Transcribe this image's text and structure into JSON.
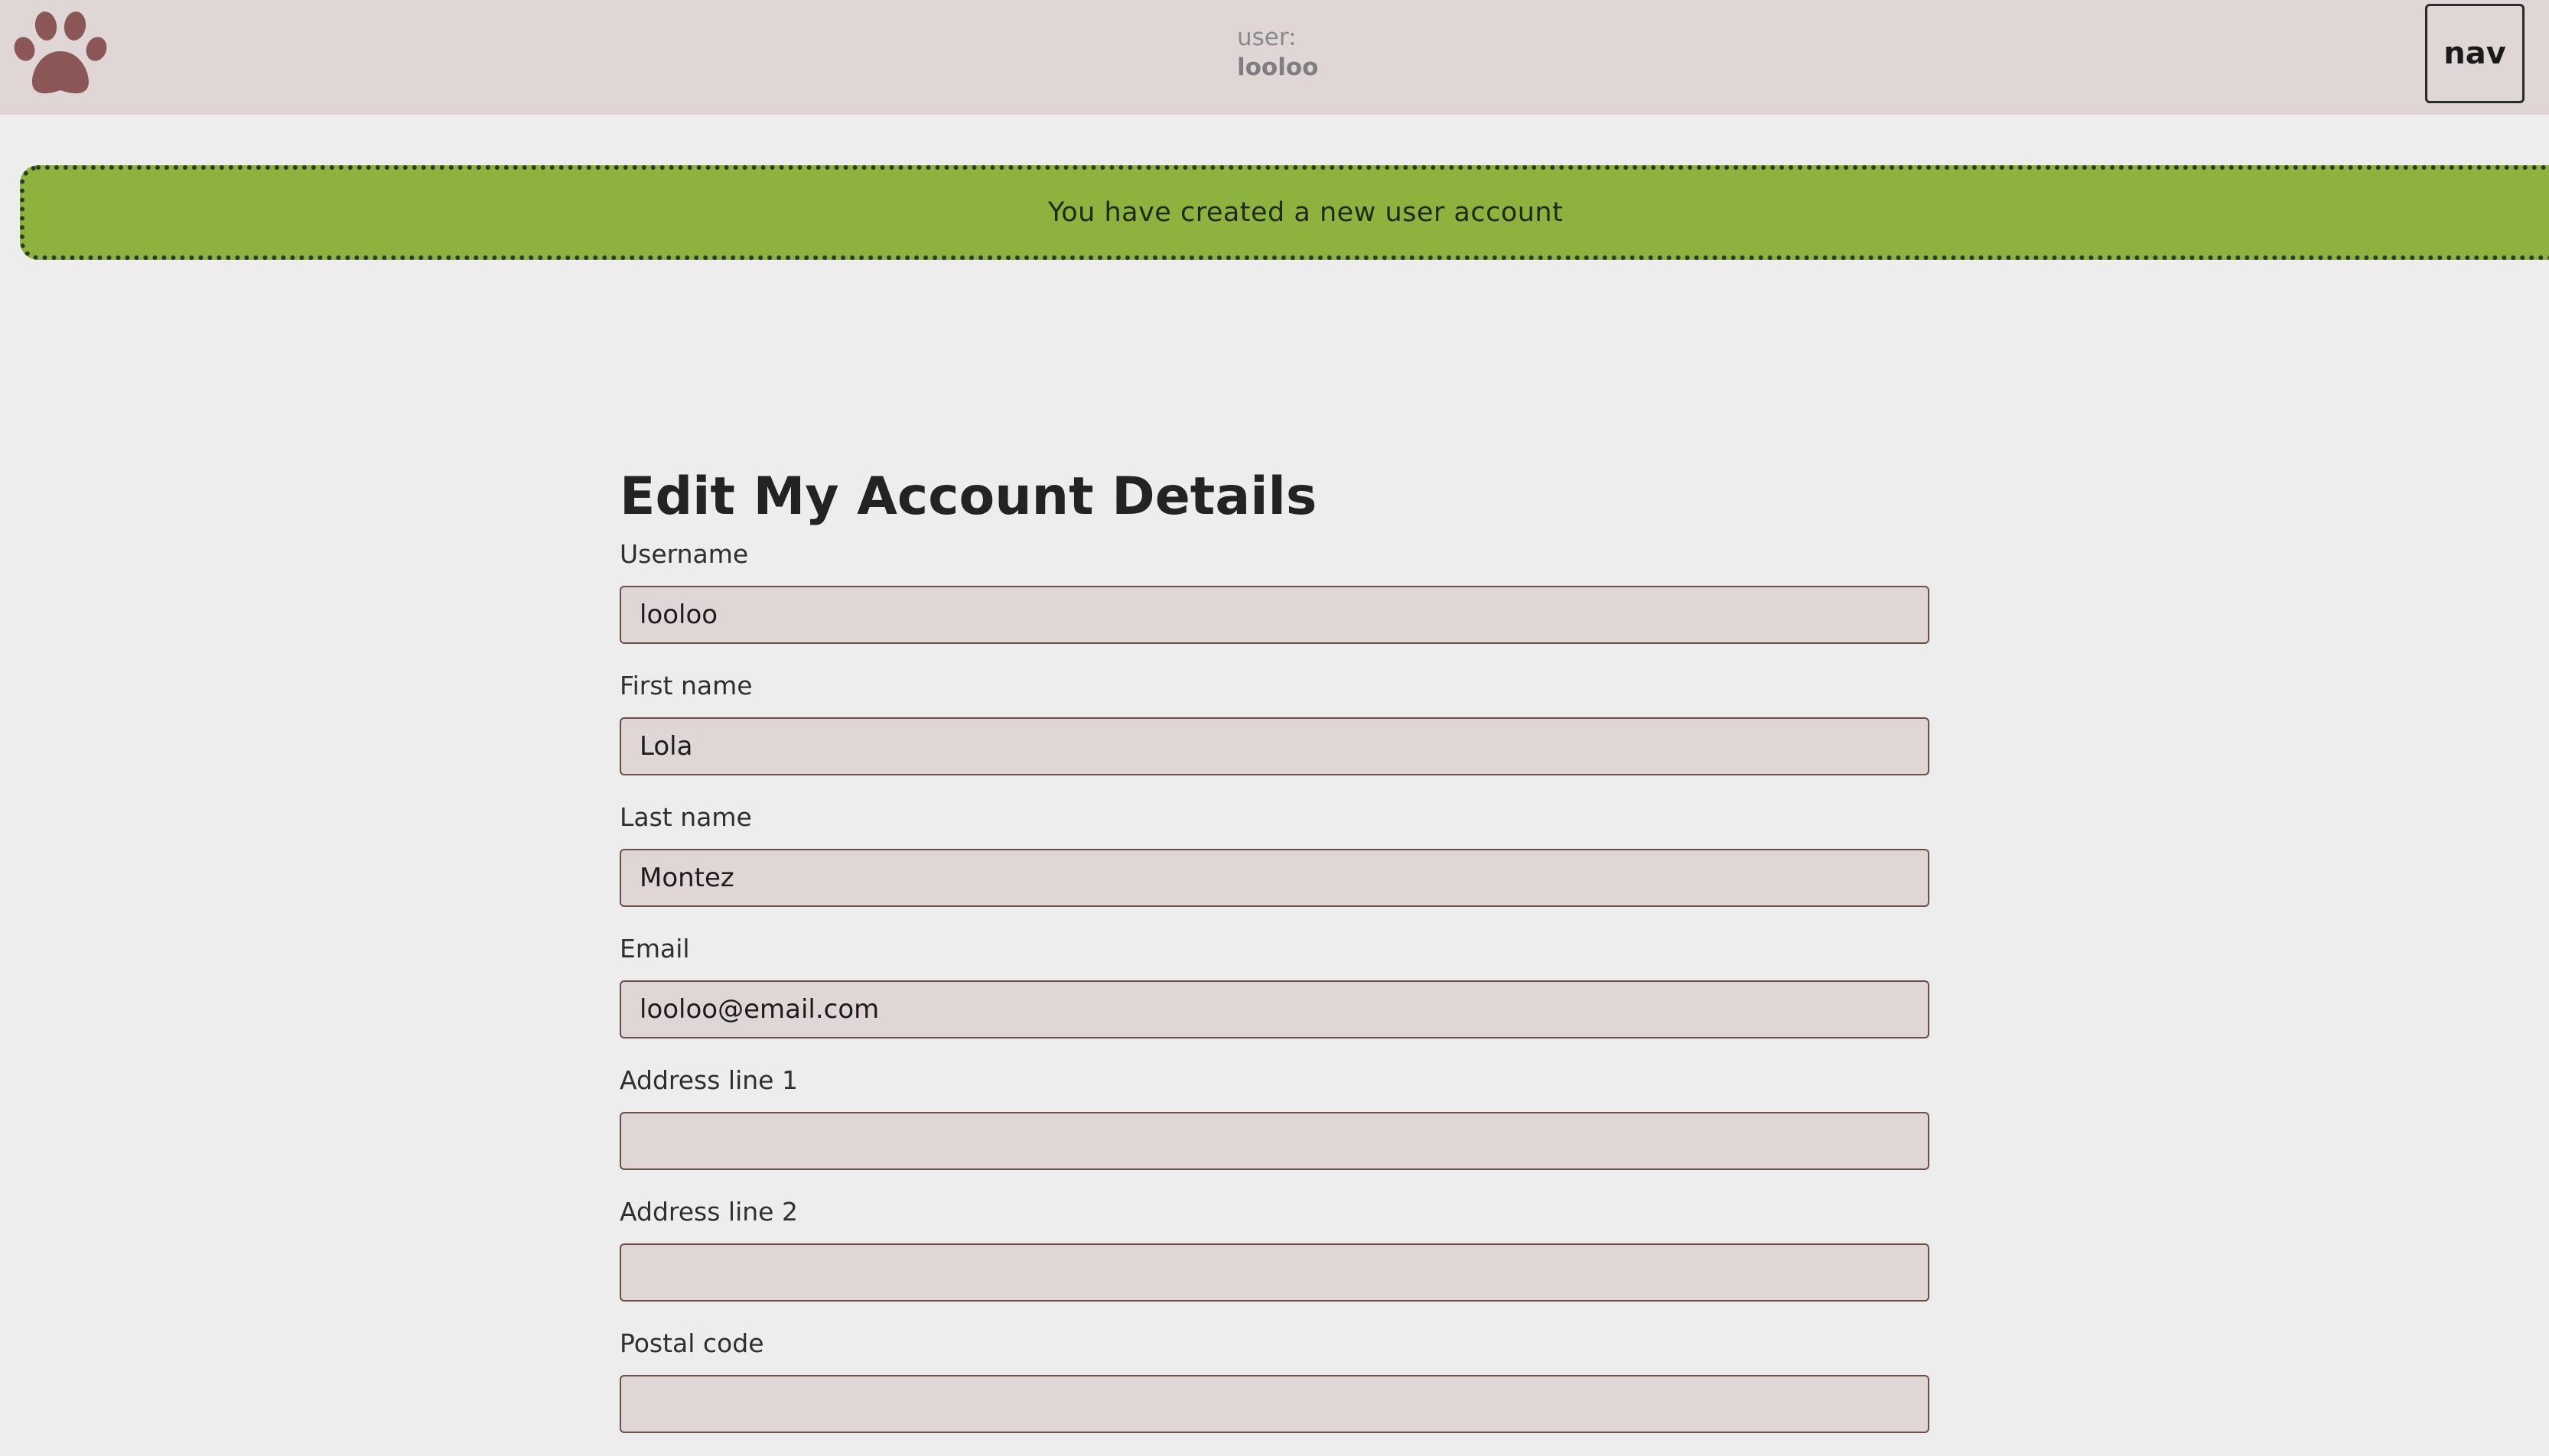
{
  "header": {
    "logo_icon": "paw-icon",
    "logo_color": "#8a5656",
    "user_label": "user:",
    "user_name": "looloo",
    "nav_label": "nav"
  },
  "alert": {
    "message": "You have created a new user account",
    "color": "#8db33e"
  },
  "form": {
    "title": "Edit My Account Details",
    "fields": [
      {
        "label": "Username",
        "value": "looloo"
      },
      {
        "label": "First name",
        "value": "Lola"
      },
      {
        "label": "Last name",
        "value": "Montez"
      },
      {
        "label": "Email",
        "value": "looloo@email.com"
      },
      {
        "label": "Address line 1",
        "value": ""
      },
      {
        "label": "Address line 2",
        "value": ""
      },
      {
        "label": "Postal code",
        "value": ""
      }
    ]
  }
}
